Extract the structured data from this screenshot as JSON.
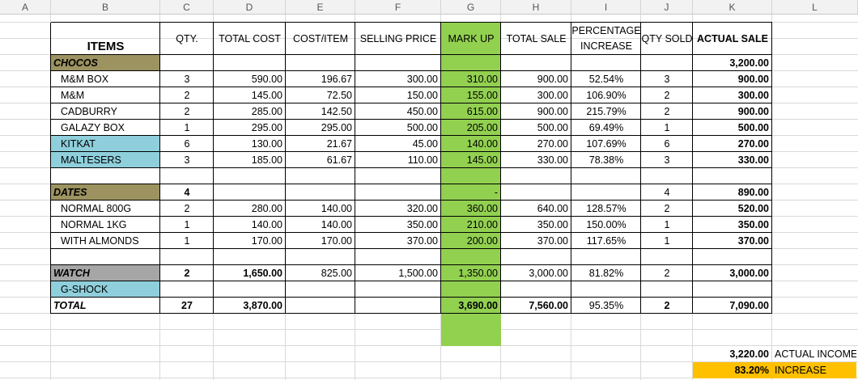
{
  "colors": {
    "header_bg": "#f2f2f2",
    "grid": "#d9d9d9",
    "olive": "#9c9361",
    "lightblue": "#8fcfdc",
    "gray": "#a6a6a6",
    "green": "#92d050",
    "yellow": "#ffc000"
  },
  "columns": [
    "A",
    "B",
    "C",
    "D",
    "E",
    "F",
    "G",
    "H",
    "I",
    "J",
    "K",
    "L"
  ],
  "header": {
    "items": "ITEMS",
    "qty": "QTY.",
    "total_cost": "TOTAL COST",
    "cost_item": "COST/ITEM",
    "selling_price": "SELLING PRICE",
    "markup": "MARK UP",
    "total_sale": "TOTAL SALE",
    "pct_increase": "PERCENTAGE INCREASE",
    "qty_sold": "QTY SOLD",
    "actual_sale": "ACTUAL SALE"
  },
  "rows": [
    {
      "cells": {
        "B": "CHOCOS",
        "K": "3,200.00"
      },
      "style": "category-olive"
    },
    {
      "cells": {
        "B": "M&M BOX",
        "C": "3",
        "D": "590.00",
        "E": "196.67",
        "F": "300.00",
        "G": "310.00",
        "H": "900.00",
        "I": "52.54%",
        "J": "3",
        "K": "900.00"
      }
    },
    {
      "cells": {
        "B": "M&M",
        "C": "2",
        "D": "145.00",
        "E": "72.50",
        "F": "150.00",
        "G": "155.00",
        "H": "300.00",
        "I": "106.90%",
        "J": "2",
        "K": "300.00"
      }
    },
    {
      "cells": {
        "B": "CADBURRY",
        "C": "2",
        "D": "285.00",
        "E": "142.50",
        "F": "450.00",
        "G": "615.00",
        "H": "900.00",
        "I": "215.79%",
        "J": "2",
        "K": "900.00"
      }
    },
    {
      "cells": {
        "B": "GALAZY BOX",
        "C": "1",
        "D": "295.00",
        "E": "295.00",
        "F": "500.00",
        "G": "205.00",
        "H": "500.00",
        "I": "69.49%",
        "J": "1",
        "K": "500.00"
      }
    },
    {
      "cells": {
        "B": "KITKAT",
        "C": "6",
        "D": "130.00",
        "E": "21.67",
        "F": "45.00",
        "G": "140.00",
        "H": "270.00",
        "I": "107.69%",
        "J": "6",
        "K": "270.00"
      },
      "style": "item-blue"
    },
    {
      "cells": {
        "B": "MALTESERS",
        "C": "3",
        "D": "185.00",
        "E": "61.67",
        "F": "110.00",
        "G": "145.00",
        "H": "330.00",
        "I": "78.38%",
        "J": "3",
        "K": "330.00"
      },
      "style": "item-blue"
    },
    {
      "cells": {}
    },
    {
      "cells": {
        "B": "DATES",
        "C": "4",
        "G": "-",
        "J": "4",
        "K": "890.00"
      },
      "style": "category-olive"
    },
    {
      "cells": {
        "B": "NORMAL 800G",
        "C": "2",
        "D": "280.00",
        "E": "140.00",
        "F": "320.00",
        "G": "360.00",
        "H": "640.00",
        "I": "128.57%",
        "J": "2",
        "K": "520.00"
      }
    },
    {
      "cells": {
        "B": "NORMAL 1KG",
        "C": "1",
        "D": "140.00",
        "E": "140.00",
        "F": "350.00",
        "G": "210.00",
        "H": "350.00",
        "I": "150.00%",
        "J": "1",
        "K": "350.00"
      }
    },
    {
      "cells": {
        "B": "WITH ALMONDS",
        "C": "1",
        "D": "170.00",
        "E": "170.00",
        "F": "370.00",
        "G": "200.00",
        "H": "370.00",
        "I": "117.65%",
        "J": "1",
        "K": "370.00"
      }
    },
    {
      "cells": {}
    },
    {
      "cells": {
        "B": "WATCH",
        "C": "2",
        "D": "1,650.00",
        "E": "825.00",
        "F": "1,500.00",
        "G": "1,350.00",
        "H": "3,000.00",
        "I": "81.82%",
        "J": "2",
        "K": "3,000.00"
      },
      "style": "category-gray"
    },
    {
      "cells": {
        "B": "G-SHOCK"
      },
      "style": "item-blue"
    },
    {
      "cells": {
        "B": "TOTAL",
        "C": "27",
        "D": "3,870.00",
        "G": "3,690.00",
        "H": "7,560.00",
        "I": "95.35%",
        "J": "2",
        "K": "7,090.00"
      },
      "style": "total"
    },
    {
      "cells": {}
    },
    {
      "cells": {}
    },
    {
      "cells": {
        "K": "3,220.00",
        "L": "ACTUAL INCOME"
      },
      "style": "income"
    },
    {
      "cells": {
        "K": "83.20%",
        "L": "INCREASE"
      },
      "style": "increase"
    }
  ]
}
